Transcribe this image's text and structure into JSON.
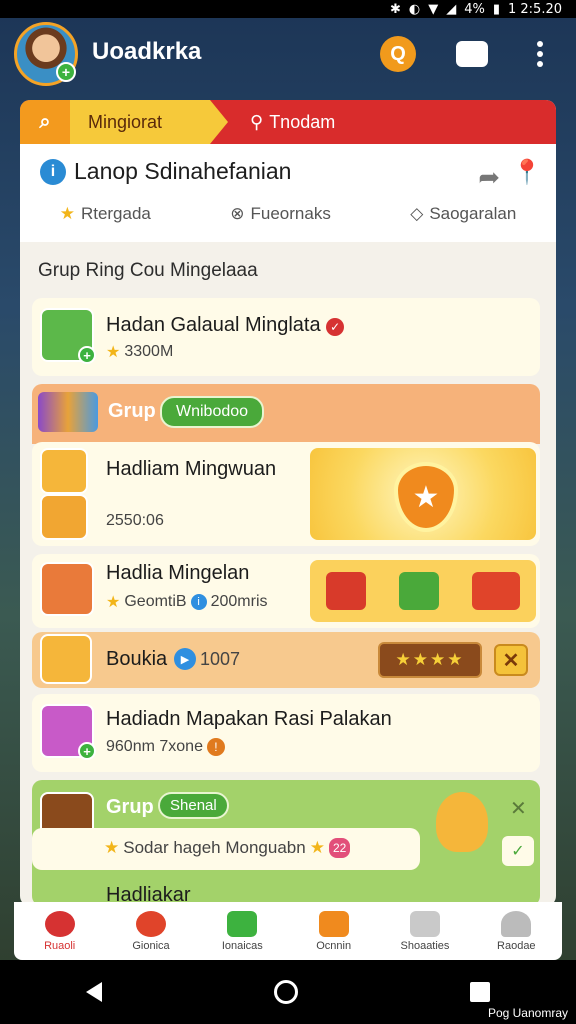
{
  "status": {
    "percent": "4%",
    "time": "1 2:5.20"
  },
  "app": {
    "title": "Uoadkrka"
  },
  "tabs": {
    "active": "Mingiorat",
    "other": "Tnodam"
  },
  "header": {
    "title": "Lanop Sdinahefanian",
    "chips": [
      "Rtergada",
      "Fueornaks",
      "Saogaralan"
    ]
  },
  "section": {
    "label": "Grup Ring Cou Mingelaaa"
  },
  "cards": [
    {
      "title": "Hadan Galaual Minglata",
      "sub": "3300M"
    },
    {
      "group_tag": "Grup",
      "group_badge": "Wnibodoo"
    },
    {
      "title": "Hadliam Mingwuan",
      "sub": "2550:06"
    },
    {
      "title": "Hadlia Mingelan",
      "sub": "GeomtiB",
      "sub2": "200mris"
    },
    {
      "title": "Boukia",
      "sub": "1007",
      "stars": "★★★★"
    },
    {
      "title": "Hadiadn Mapakan Rasi Palakan",
      "sub": "960nm 7xone"
    },
    {
      "group_tag": "Grup",
      "group_badge": "Shenal",
      "inner_text": "Sodar hageh Monguabn",
      "inner_badge": "22"
    },
    {
      "title": "Hadliakar"
    }
  ],
  "bottom_nav": [
    "Ruaoli",
    "Gionica",
    "Ionaicas",
    "Ocnnin",
    "Shoaaties",
    "Raodae"
  ],
  "sys": {
    "label": "Pog Uanomray"
  }
}
